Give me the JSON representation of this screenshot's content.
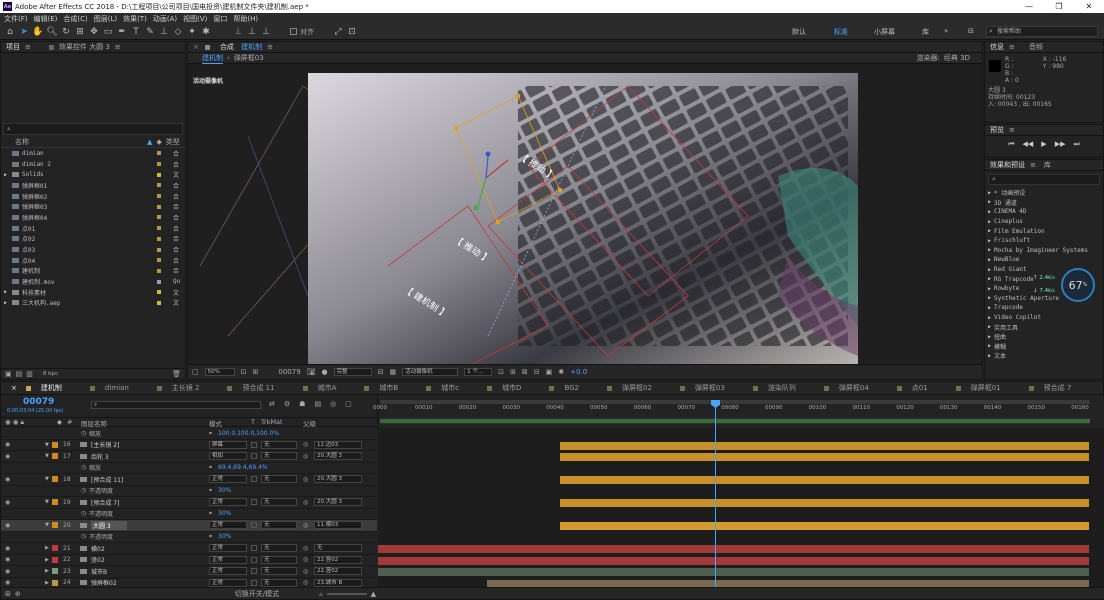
{
  "window": {
    "title": "Adobe After Effects CC 2018 - D:\\工程项目\\公司项目\\国电投资\\建机制文件夹\\建机制.aep *",
    "logo": "Ae"
  },
  "menu": [
    "文件(F)",
    "编辑(E)",
    "合成(C)",
    "图层(L)",
    "效果(T)",
    "动画(A)",
    "视图(V)",
    "窗口",
    "帮助(H)"
  ],
  "toolbar": {
    "snap": "对齐",
    "workspaces": [
      "默认",
      "标准",
      "小屏幕",
      "库"
    ],
    "active_ws": "标准",
    "search_placeholder": "搜索帮助"
  },
  "project": {
    "tab": "项目",
    "tab2": "效果控件 大圆 3",
    "search": "",
    "col_name": "名称",
    "col_type": "类型",
    "items": [
      {
        "name": "dimian",
        "color": "#b59a4a",
        "type": "合"
      },
      {
        "name": "dimian 2",
        "color": "#b59a4a",
        "type": "合"
      },
      {
        "name": "Solids",
        "color": "#c9c13a",
        "type": "文"
      },
      {
        "name": "弹屏框01",
        "color": "#b59a4a",
        "type": "合"
      },
      {
        "name": "弹屏框02",
        "color": "#b59a4a",
        "type": "合"
      },
      {
        "name": "弹屏框03",
        "color": "#b59a4a",
        "type": "合"
      },
      {
        "name": "弹屏框04",
        "color": "#b59a4a",
        "type": "合"
      },
      {
        "name": "点01",
        "color": "#b59a4a",
        "type": "合"
      },
      {
        "name": "点02",
        "color": "#b59a4a",
        "type": "合"
      },
      {
        "name": "点03",
        "color": "#b59a4a",
        "type": "合"
      },
      {
        "name": "点04",
        "color": "#b59a4a",
        "type": "合"
      },
      {
        "name": "建机制",
        "color": "#b59a4a",
        "type": "合"
      },
      {
        "name": "建机制.mov",
        "color": "#8aa3c0",
        "type": "Qu"
      },
      {
        "name": "科技素材",
        "color": "#c9c13a",
        "type": "文"
      },
      {
        "name": "三大机构.aep",
        "color": "#c9c13a",
        "type": "文"
      }
    ],
    "bpc": "8 bpc"
  },
  "comp": {
    "tab": "合成",
    "tab_name": "建机制",
    "crumbs": [
      "建机制",
      "弹屏框03"
    ],
    "camera_label": "活动摄像机",
    "renderer_label": "渲染器:",
    "renderer": "经典 3D",
    "zoom": "50%",
    "timecode": "00079",
    "quality": "完整",
    "camera": "活动摄像机",
    "views": "1 个...",
    "exposure": "+0.0",
    "labels": [
      "【 推动 】",
      "【 推动 】",
      "【 建机制 】"
    ]
  },
  "info": {
    "tab": "信息",
    "tab2": "音频",
    "r": "R :",
    "g": "G :",
    "b": "B :",
    "a": "A : 0",
    "x": "X : -116",
    "y": "Y : 980",
    "layer": "大圆 3",
    "duration": "持续时间: 00123",
    "inout": "入: 00043 , 出: 00165"
  },
  "preview": {
    "tab": "预览"
  },
  "effects": {
    "tab": "效果和预设",
    "tab2": "库",
    "search": "",
    "items": [
      "* 动画预设",
      "3D 通道",
      "CINEMA 4D",
      "Cineplus",
      "Film Emulation",
      "Frischluft",
      "Mocha by Imagineer Systems",
      "NewBlue",
      "Red Giant",
      "RG Trapcode",
      "Rowbyte",
      "Synthetic Aperture",
      "Trapcode",
      "Video Copilot",
      "实用工具",
      "扭曲",
      "模糊",
      "文本"
    ],
    "perf": "67",
    "up": "2.4",
    "down": "7.4",
    "unit": "K/s",
    "pct": "%"
  },
  "timeline": {
    "tabs": [
      "建机制",
      "dimian",
      "主长镜 2",
      "预合成 11",
      "城市A",
      "城市B",
      "城市c",
      "城市D",
      "BG2",
      "弹屏框02",
      "弹屏框03",
      "渲染队列",
      "弹屏框04",
      "点01",
      "弹屏框01",
      "预合成 7"
    ],
    "timecode": "00079",
    "sub": "0:00:03:04 (25.00 fps)",
    "search": "",
    "cols": {
      "name": "图层名称",
      "mode": "模式",
      "t": "T",
      "trk": "TrkMat",
      "parent": "父级"
    },
    "ticks": [
      "0000",
      "00010",
      "00020",
      "00030",
      "00040",
      "00050",
      "00060",
      "00070",
      "00080",
      "00090",
      "00100",
      "00110",
      "00120",
      "00130",
      "00140",
      "00150",
      "00160"
    ],
    "footer": "切换开关/模式",
    "rows": [
      {
        "kind": "sub",
        "label": "缩放",
        "val": "100.0,100.0,100.0%"
      },
      {
        "kind": "layer",
        "num": "16",
        "name": "[主长镜 2]",
        "mode": "屏幕",
        "trk": "无",
        "parent": "12.边03",
        "color": "#d08a1f",
        "bar": "#c8902a",
        "barStart": 0.25
      },
      {
        "kind": "layer",
        "num": "17",
        "name": "齿轮 3",
        "mode": "相加",
        "trk": "无",
        "parent": "20.大圆 3",
        "color": "#d08a1f",
        "bar": "#c8902a",
        "barStart": 0.25
      },
      {
        "kind": "sub",
        "label": "缩放",
        "val": "69.4,69.4,69.4%"
      },
      {
        "kind": "layer",
        "num": "18",
        "name": "[预合成 11]",
        "mode": "正常",
        "trk": "无",
        "parent": "20.大圆 3",
        "color": "#d08a1f",
        "bar": "#c8902a",
        "barStart": 0.25
      },
      {
        "kind": "sub",
        "label": "不透明度",
        "val": "30%"
      },
      {
        "kind": "layer",
        "num": "19",
        "name": "[预合成 7]",
        "mode": "正常",
        "trk": "无",
        "parent": "20.大圆 3",
        "color": "#d08a1f",
        "bar": "#c8902a",
        "barStart": 0.25
      },
      {
        "kind": "sub",
        "label": "不透明度",
        "val": "30%"
      },
      {
        "kind": "layer",
        "num": "20",
        "name": "大圆 3",
        "mode": "正常",
        "trk": "无",
        "parent": "11.横03",
        "color": "#d08a1f",
        "bar": "#d49a30",
        "barStart": 0.25,
        "selected": true
      },
      {
        "kind": "sub",
        "label": "不透明度",
        "val": "30%"
      },
      {
        "kind": "layer",
        "num": "21",
        "name": "横02",
        "mode": "正常",
        "trk": "无",
        "parent": "无",
        "color": "#c23b3b",
        "bar": "#a33a3a",
        "barStart": 0
      },
      {
        "kind": "layer",
        "num": "22",
        "name": "竖02",
        "mode": "正常",
        "trk": "无",
        "parent": "22.竖02",
        "color": "#c23b3b",
        "bar": "#a33a3a",
        "barStart": 0
      },
      {
        "kind": "layer",
        "num": "23",
        "name": "城市B",
        "mode": "正常",
        "trk": "无",
        "parent": "22.竖02",
        "color": "#7d9a7d",
        "bar": "#4d5f4d",
        "barStart": 0
      },
      {
        "kind": "layer",
        "num": "24",
        "name": "弹屏框02",
        "mode": "正常",
        "trk": "无",
        "parent": "23.城市 B",
        "color": "#b59a4a",
        "bar": "#7a6a50",
        "barStart": 0.15
      }
    ]
  }
}
